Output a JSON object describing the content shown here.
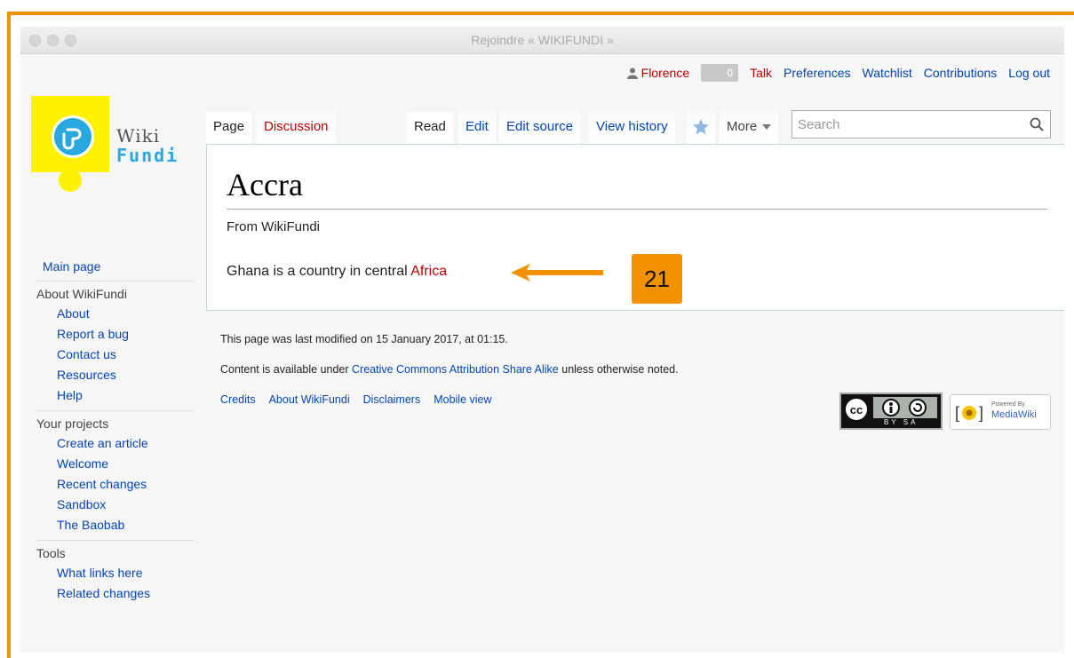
{
  "window": {
    "title": "Rejoindre « WIKIFUNDI »"
  },
  "personal": {
    "username": "Florence",
    "notifications": "0",
    "links": [
      "Talk",
      "Preferences",
      "Watchlist",
      "Contributions",
      "Log out"
    ]
  },
  "logo": {
    "line1": "Wiki",
    "line2": "Fundi"
  },
  "tabs": {
    "page": "Page",
    "discussion": "Discussion",
    "read": "Read",
    "edit": "Edit",
    "edit_source": "Edit source",
    "view_history": "View history",
    "more": "More"
  },
  "search": {
    "placeholder": "Search"
  },
  "sidebar": {
    "main_page": "Main page",
    "sections": [
      {
        "heading": "About WikiFundi",
        "items": [
          "About",
          "Report a bug",
          "Contact us",
          "Resources",
          "Help"
        ]
      },
      {
        "heading": "Your projects",
        "items": [
          "Create an article",
          "Welcome",
          "Recent changes",
          "Sandbox",
          "The Baobab"
        ]
      },
      {
        "heading": "Tools",
        "items": [
          "What links here",
          "Related changes"
        ]
      }
    ]
  },
  "article": {
    "title": "Accra",
    "tagline": "From WikiFundi",
    "text_before": "Ghana is a country in central ",
    "link": "Africa"
  },
  "annotation": {
    "number": "21",
    "color": "#f39200"
  },
  "footer": {
    "last_modified": "This page was last modified on 15 January 2017, at 01:15.",
    "license_before": "Content is available under ",
    "license_link": "Creative Commons Attribution Share Alike",
    "license_after": " unless otherwise noted.",
    "links": [
      "Credits",
      "About WikiFundi",
      "Disclaimers",
      "Mobile view"
    ],
    "cc_badge": "BY SA",
    "powered_small": "Powered By",
    "powered_name": "MediaWiki"
  },
  "colors": {
    "link": "#0645ad",
    "redlink": "#ba0000",
    "accent_frame": "#f39200",
    "logo_yellow": "#fff200",
    "logo_blue": "#29a7df"
  },
  "icons": [
    "user-icon",
    "star-watch-icon",
    "dropdown-arrow-icon",
    "search-icon",
    "cc-license-icon",
    "mediawiki-icon"
  ]
}
